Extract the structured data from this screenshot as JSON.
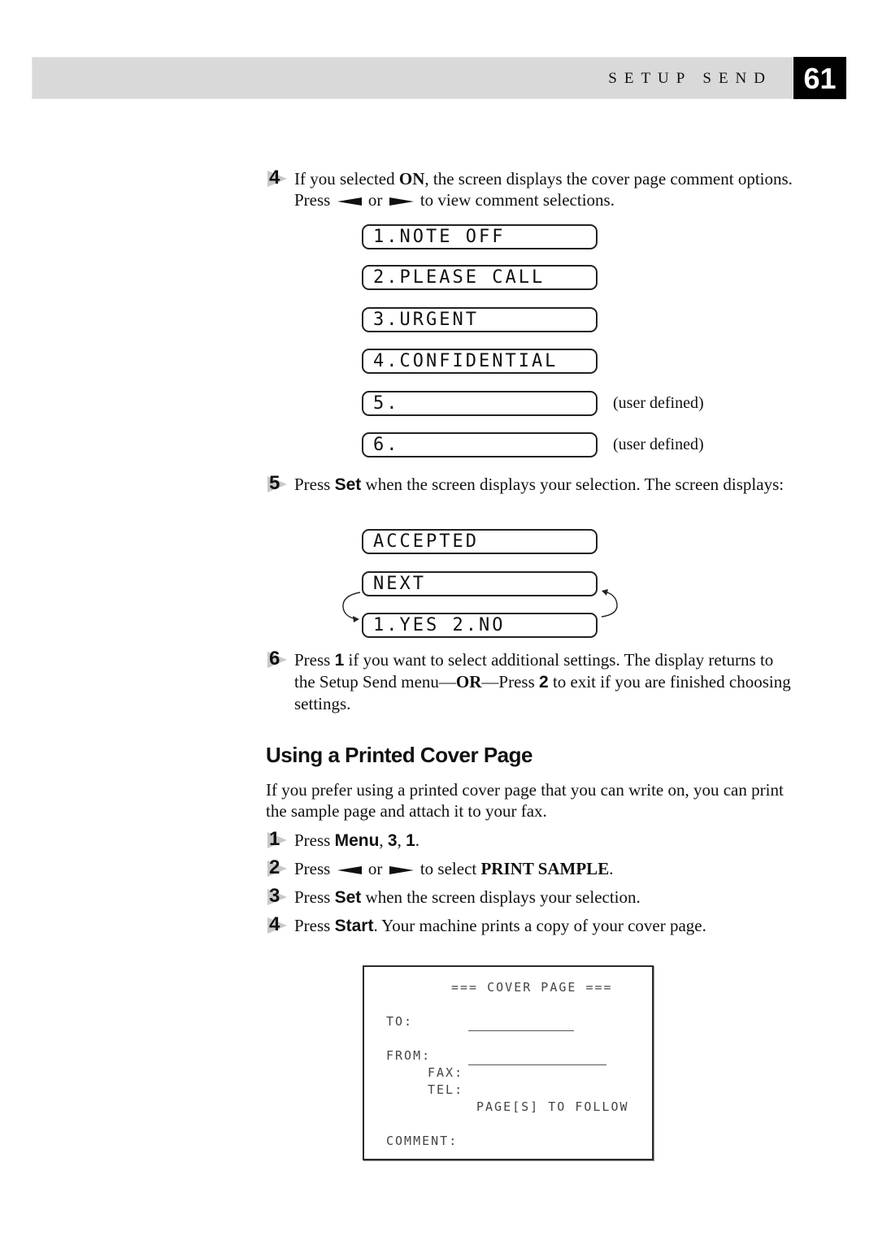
{
  "header": {
    "section_title": "SETUP SEND",
    "page_number": "61"
  },
  "steps_a": [
    {
      "number": "4",
      "parts": {
        "t1": "If you selected ",
        "b1": "ON",
        "t2": ", the screen displays the cover page comment options. Press ",
        "t3": " or ",
        "t4": " to view comment selections."
      }
    },
    {
      "number": "5",
      "parts": {
        "t1": "Press ",
        "b1": "Set",
        "t2": " when the screen displays your selection. The screen displays:"
      }
    },
    {
      "number": "6",
      "parts": {
        "t1": "Press ",
        "b1": "1",
        "t2": " if you want to select additional settings. The display returns to the Setup Send menu—",
        "b2": "OR",
        "t3": "—Press ",
        "b3": "2",
        "t4": " to exit if you are finished choosing settings."
      }
    }
  ],
  "comment_options": [
    {
      "display": "1.NOTE OFF",
      "note": ""
    },
    {
      "display": "2.PLEASE CALL",
      "note": ""
    },
    {
      "display": "3.URGENT",
      "note": ""
    },
    {
      "display": "4.CONFIDENTIAL",
      "note": ""
    },
    {
      "display": "5.",
      "note": "(user defined)"
    },
    {
      "display": "6.",
      "note": "(user defined)"
    }
  ],
  "result_displays": [
    "ACCEPTED",
    "NEXT",
    "1.YES 2.NO"
  ],
  "section": {
    "heading": "Using a Printed Cover Page",
    "intro": "If you prefer using a printed cover page that you can write on, you can print the sample page and attach it to your fax."
  },
  "steps_b": [
    {
      "number": "1",
      "t1": "Press ",
      "b1": "Menu",
      "t2": ", ",
      "b2": "3",
      "t3": ", ",
      "b3": "1",
      "t4": "."
    },
    {
      "number": "2",
      "t1": "Press ",
      "t2": " or ",
      "t3": " to select ",
      "b1": "PRINT SAMPLE",
      "t4": "."
    },
    {
      "number": "3",
      "t1": "Press ",
      "b1": "Set",
      "t2": " when the screen displays your selection."
    },
    {
      "number": "4",
      "t1": "Press ",
      "b1": "Start",
      "t2": ". Your machine prints a copy of your cover page."
    }
  ],
  "cover_sample": {
    "title": "=== COVER PAGE ===",
    "to_label": "TO:",
    "from_label": "FROM:",
    "fax_label": "FAX:",
    "tel_label": "TEL:",
    "pages_label": "PAGE[S] TO FOLLOW",
    "comment_label": "COMMENT:"
  }
}
